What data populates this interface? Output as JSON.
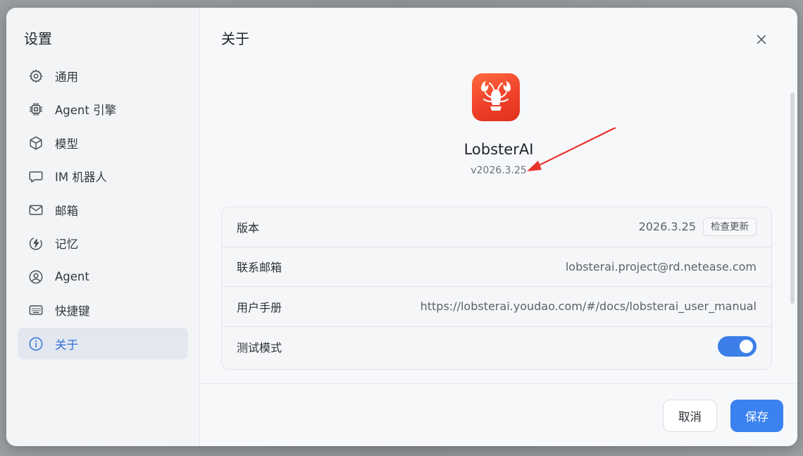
{
  "sidebar": {
    "title": "设置",
    "items": [
      {
        "label": "通用",
        "icon": "gear-icon"
      },
      {
        "label": "Agent 引擎",
        "icon": "chip-icon"
      },
      {
        "label": "模型",
        "icon": "cube-icon"
      },
      {
        "label": "IM 机器人",
        "icon": "chat-bubble-icon"
      },
      {
        "label": "邮箱",
        "icon": "mail-icon"
      },
      {
        "label": "记忆",
        "icon": "lightning-icon"
      },
      {
        "label": "Agent",
        "icon": "user-circle-icon"
      },
      {
        "label": "快捷键",
        "icon": "keyboard-icon"
      },
      {
        "label": "关于",
        "icon": "info-icon"
      }
    ],
    "active_index": 8
  },
  "main": {
    "title": "关于",
    "app": {
      "name": "LobsterAI",
      "version": "v2026.3.25"
    },
    "rows": {
      "version": {
        "label": "版本",
        "value": "2026.3.25",
        "action": "检查更新"
      },
      "email": {
        "label": "联系邮箱",
        "value": "lobsterai.project@rd.netease.com"
      },
      "manual": {
        "label": "用户手册",
        "value": "https://lobsterai.youdao.com/#/docs/lobsterai_user_manual"
      },
      "test_mode": {
        "label": "测试模式",
        "enabled": true
      }
    }
  },
  "footer": {
    "cancel_label": "取消",
    "save_label": "保存"
  },
  "colors": {
    "accent": "#3b82f0",
    "active_bg": "#e2e7f0",
    "annotation_arrow": "#e8312a",
    "logo": "#f0412a"
  }
}
